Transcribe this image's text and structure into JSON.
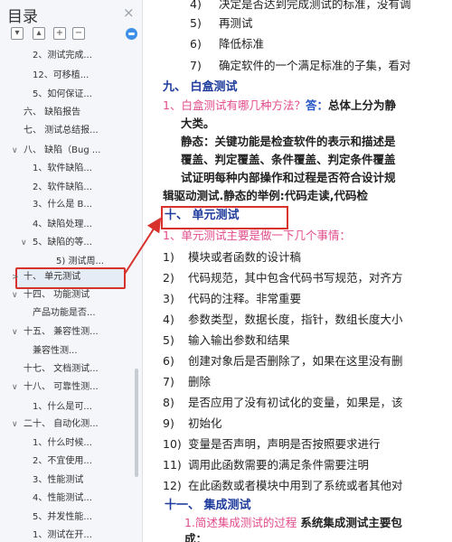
{
  "sidebar": {
    "title": "目录",
    "close_icon": "×",
    "toolbar_icons": [
      "collapse-icon",
      "expand-icon",
      "add-icon",
      "remove-icon"
    ],
    "items": [
      {
        "text": "2、测试完成...",
        "indent": 2,
        "chevron": ""
      },
      {
        "text": "12、可移植...",
        "indent": 2,
        "chevron": ""
      },
      {
        "text": "5、如何保证...",
        "indent": 2,
        "chevron": ""
      },
      {
        "text": "六、 缺陷报告",
        "indent": 1,
        "chevron": ""
      },
      {
        "text": "七、 测试总结报...",
        "indent": 1,
        "chevron": ""
      },
      {
        "text": "八、 缺陷（Bug ...",
        "indent": 1,
        "chevron": "∨"
      },
      {
        "text": "1、软件缺陷...",
        "indent": 2,
        "chevron": ""
      },
      {
        "text": "2、软件缺陷...",
        "indent": 2,
        "chevron": ""
      },
      {
        "text": "3、什么是 B...",
        "indent": 2,
        "chevron": ""
      },
      {
        "text": "4、缺陷处理...",
        "indent": 2,
        "chevron": ""
      },
      {
        "text": "5、缺陷的等...",
        "indent": 2,
        "chevron": "∨"
      },
      {
        "text": "5) 测试周...",
        "indent": 3,
        "chevron": ""
      },
      {
        "text": "十、 单元测试",
        "indent": 1,
        "chevron": ">"
      },
      {
        "text": "十四、 功能测试",
        "indent": 1,
        "chevron": "∨"
      },
      {
        "text": "产品功能是否...",
        "indent": 2,
        "chevron": ""
      },
      {
        "text": "十五、 兼容性测...",
        "indent": 1,
        "chevron": "∨"
      },
      {
        "text": "兼容性测...",
        "indent": 2,
        "chevron": ""
      },
      {
        "text": "十七、 文档测试...",
        "indent": 1,
        "chevron": ""
      },
      {
        "text": "十八、 可靠性测...",
        "indent": 1,
        "chevron": "∨"
      },
      {
        "text": "1、什么是可...",
        "indent": 2,
        "chevron": ""
      },
      {
        "text": "二十、 自动化测...",
        "indent": 1,
        "chevron": "∨"
      },
      {
        "text": "1、什么时候...",
        "indent": 2,
        "chevron": ""
      },
      {
        "text": "2、不宜使用...",
        "indent": 2,
        "chevron": ""
      },
      {
        "text": "3、性能测试",
        "indent": 2,
        "chevron": ""
      },
      {
        "text": "4、性能测试...",
        "indent": 2,
        "chevron": ""
      },
      {
        "text": "5、并发性能...",
        "indent": 2,
        "chevron": ""
      },
      {
        "text": "1、测试在开...",
        "indent": 2,
        "chevron": ""
      }
    ],
    "active_index": 12
  },
  "document": {
    "top_items": [
      {
        "num": "4)",
        "text": "决定是否达到完成测试的标准，没有调"
      },
      {
        "num": "5)",
        "text": "再测试"
      },
      {
        "num": "6)",
        "text": "降低标准"
      },
      {
        "num": "7)",
        "text": "确定软件的一个满足标准的子集，看对"
      }
    ],
    "h9": "九、    白盒测试",
    "q1_prefix": "1、白盒测试有哪几种方法？",
    "q1_answer_label": "答：",
    "q1_answer_start": "总体上分为静",
    "q1_lines": [
      "大类。",
      "静态：关键功能是检查软件的表示和描述是",
      "覆盖、判定覆盖、条件覆盖、判定条件覆盖",
      "试证明每种内部操作和过程是否符合设计规",
      "辑驱动测试.静态的举例:代码走读,代码检"
    ],
    "h10": "十、    单元测试",
    "q2": "1、单元测试主要是做一下几个事情：",
    "unit_items": [
      {
        "num": "1)",
        "text": "模块或者函数的设计稿"
      },
      {
        "num": "2)",
        "text": "代码规范，其中包含代码书写规范，对齐方"
      },
      {
        "num": "3)",
        "text": "代码的注释。非常重要"
      },
      {
        "num": "4)",
        "text": "参数类型，数据长度，指针，数组长度大小"
      },
      {
        "num": "5)",
        "text": "输入输出参数和结果"
      },
      {
        "num": "6)",
        "text": "创建对象后是否删除了，如果在这里没有删"
      },
      {
        "num": "7)",
        "text": "删除"
      },
      {
        "num": "8)",
        "text": "是否应用了没有初试化的变量，如果是，该"
      },
      {
        "num": "9)",
        "text": "初始化"
      },
      {
        "num": "10)",
        "text": "变量是否声明，声明是否按照要求进行"
      },
      {
        "num": "11)",
        "text": "调用此函数需要的满足条件需要注明"
      },
      {
        "num": "12)",
        "text": "在此函数或者模块中用到了系统或者其他对"
      }
    ],
    "h11": "十一、    集成测试",
    "q3_prefix": "1.简述集成测试的过程",
    "q3_rest": "系统集成测试主要包",
    "q3_line2": "成："
  },
  "colors": {
    "heading": "#1f3c9c",
    "pink": "#e24c8b",
    "highlight_box": "#d7322c"
  }
}
